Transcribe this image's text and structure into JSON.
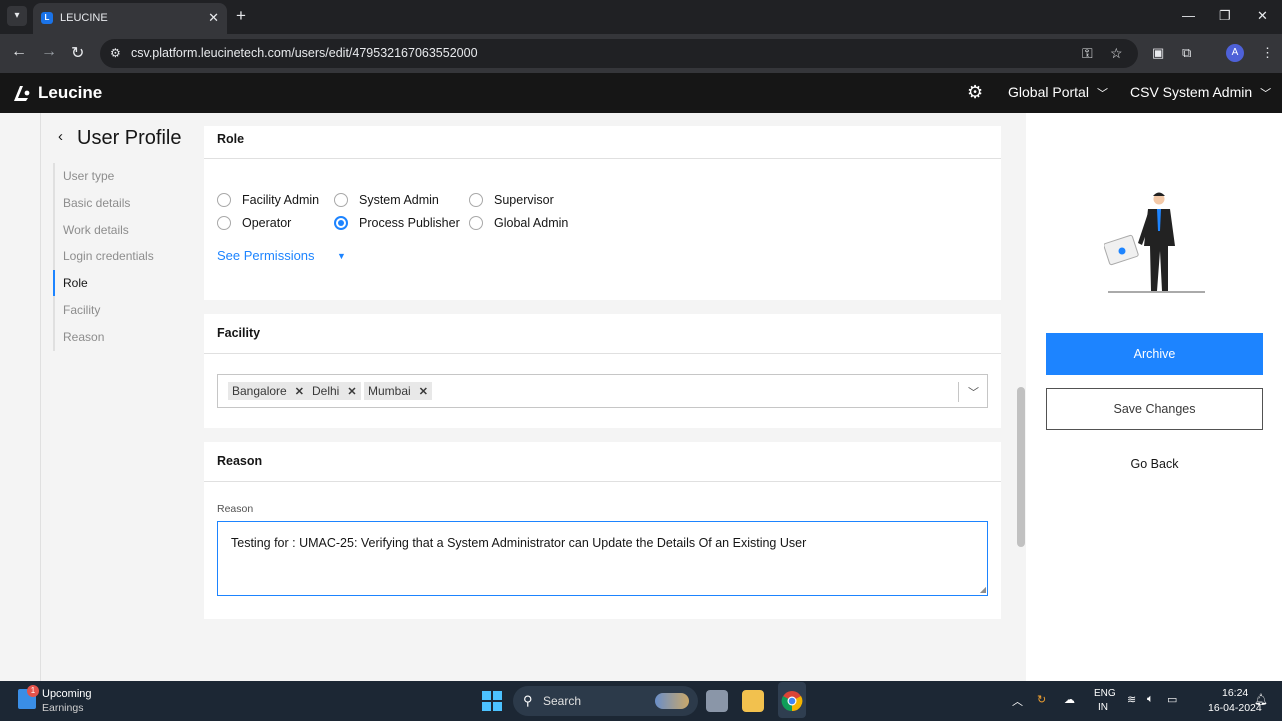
{
  "browser": {
    "tab_title": "LEUCINE",
    "url": "csv.platform.leucinetech.com/users/edit/479532167063552000",
    "profile_initial": "A"
  },
  "app": {
    "brand": "Leucine",
    "portal_menu": "Global Portal",
    "user_menu": "CSV System Admin"
  },
  "page": {
    "title": "User Profile",
    "steps": [
      "User type",
      "Basic details",
      "Work details",
      "Login credentials",
      "Role",
      "Facility",
      "Reason"
    ],
    "active_step": "Role"
  },
  "role": {
    "heading": "Role",
    "options": [
      {
        "label": "Facility Admin",
        "checked": false
      },
      {
        "label": "System Admin",
        "checked": false
      },
      {
        "label": "Supervisor",
        "checked": false
      },
      {
        "label": "Operator",
        "checked": false
      },
      {
        "label": "Process Publisher",
        "checked": true
      },
      {
        "label": "Global Admin",
        "checked": false
      }
    ],
    "permissions_link": "See Permissions"
  },
  "facility": {
    "heading": "Facility",
    "selected": [
      "Bangalore",
      "Delhi",
      "Mumbai"
    ]
  },
  "reason": {
    "heading": "Reason",
    "label": "Reason",
    "value": "Testing for : UMAC-25: Verifying that a System Administrator can Update the Details Of an Existing User"
  },
  "actions": {
    "archive": "Archive",
    "save": "Save Changes",
    "go_back": "Go Back"
  },
  "taskbar": {
    "widget_title": "Upcoming",
    "widget_sub": "Earnings",
    "widget_badge": "1",
    "search": "Search",
    "lang_line1": "ENG",
    "lang_line2": "IN",
    "time": "16:24",
    "date": "16-04-2024"
  },
  "colors": {
    "accent": "#1d84ff",
    "header_bg": "#161616"
  }
}
